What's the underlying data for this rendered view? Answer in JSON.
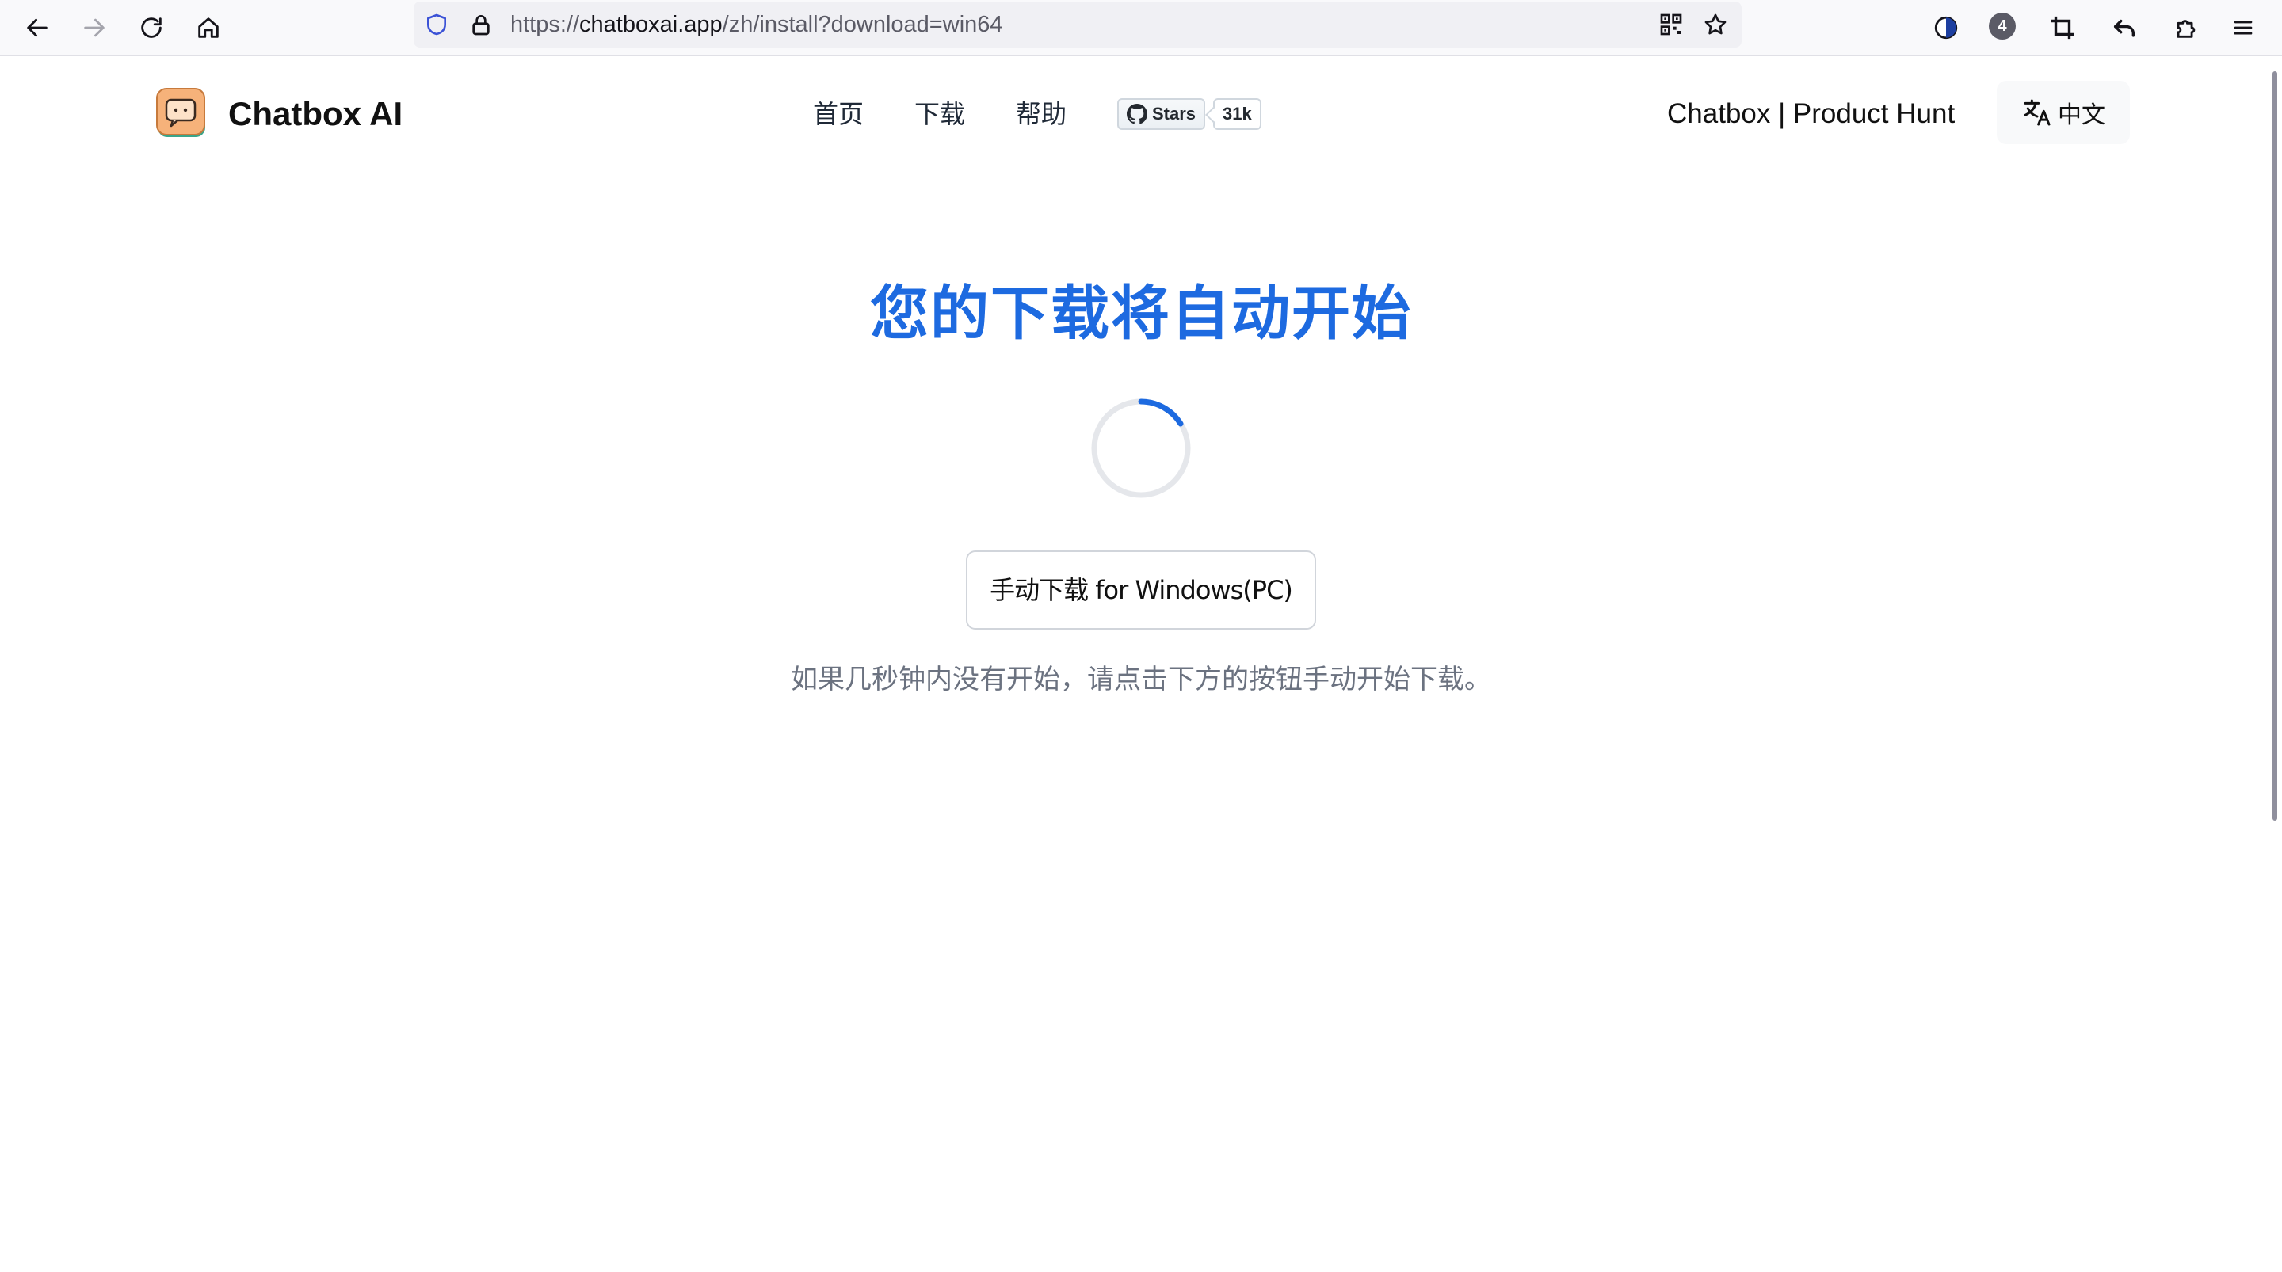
{
  "browser": {
    "url_prefix": "https://",
    "url_host": "chatboxai.app",
    "url_path": "/zh/install?download=win64",
    "extension_badge": "4",
    "icons": {
      "back": "arrow-left-icon",
      "forward": "arrow-right-icon",
      "reload": "reload-icon",
      "home": "home-icon",
      "shield": "shield-icon",
      "lock": "lock-icon",
      "qr": "qr-code-icon",
      "bookmark": "star-icon",
      "dark_reader": "half-moon-icon",
      "crop": "crop-icon",
      "undo": "undo-icon",
      "extensions": "puzzle-icon",
      "menu": "hamburger-icon"
    }
  },
  "header": {
    "brand": "Chatbox AI",
    "nav": [
      "首页",
      "下载",
      "帮助"
    ],
    "github": {
      "label": "Stars",
      "count": "31k"
    },
    "product_hunt": "Chatbox | Product Hunt",
    "language": "中文"
  },
  "main": {
    "headline": "您的下载将自动开始",
    "manual_button": "手动下载 for Windows(PC)",
    "hint": "如果几秒钟内没有开始，请点击下方的按钮手动开始下载。"
  },
  "colors": {
    "accent": "#1d6ae0",
    "hint_text": "#6b7280",
    "logo_bg": "#f6b27a"
  }
}
